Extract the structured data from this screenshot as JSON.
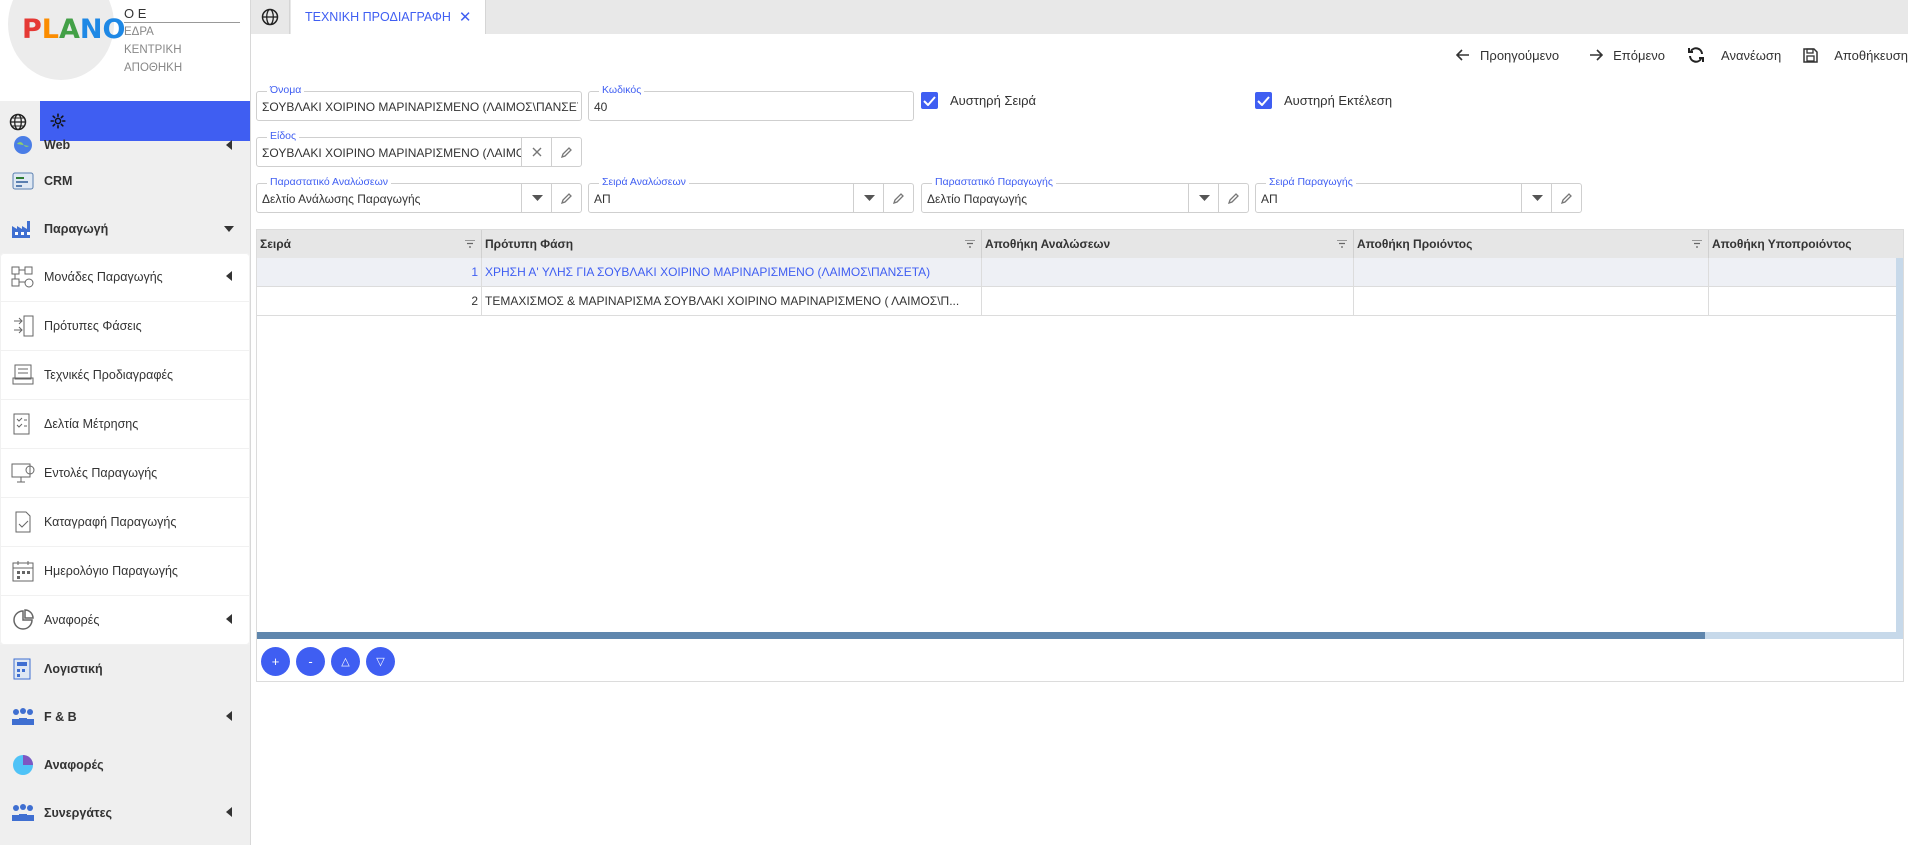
{
  "logo": {
    "text_letters": [
      "P",
      "L",
      "A",
      "N",
      "O"
    ],
    "letter_colors": [
      "#e53935",
      "#fb8c00",
      "#43a047",
      "#1e88e5",
      "#1e88e5"
    ]
  },
  "company": {
    "name": "O E",
    "lines": [
      "ΕΔΡΑ",
      "ΚΕΝΤΡΙΚΗ",
      "ΑΠΟΘΗΚΗ"
    ]
  },
  "colors": {
    "accent": "#3f5ef2",
    "sidebar_bg": "#efefef",
    "header_bg": "#e6e6e6",
    "scroll_track": "#c7d9ea",
    "scroll_thumb": "#5f86ad"
  },
  "sidebar": {
    "items": [
      {
        "label": "Web",
        "icon": "globe-color-icon"
      },
      {
        "label": "CRM",
        "icon": "crm-icon"
      },
      {
        "label": "Παραγωγή",
        "icon": "factory-icon"
      }
    ],
    "sub_items": [
      {
        "label": "Μονάδες Παραγωγής",
        "icon": "units-icon"
      },
      {
        "label": "Πρότυπες Φάσεις",
        "icon": "phases-icon"
      },
      {
        "label": "Τεχνικές Προδιαγραφές",
        "icon": "specs-icon"
      },
      {
        "label": "Δελτία Μέτρησης",
        "icon": "measurement-icon"
      },
      {
        "label": "Εντολές Παραγωγής",
        "icon": "orders-icon"
      },
      {
        "label": "Καταγραφή Παραγωγής",
        "icon": "record-icon"
      },
      {
        "label": "Ημερολόγιο Παραγωγής",
        "icon": "calendar-icon"
      },
      {
        "label": "Αναφορές",
        "icon": "reports-icon"
      }
    ],
    "bottom_items": [
      {
        "label": "Λογιστική",
        "icon": "accounting-icon"
      },
      {
        "label": "F & B",
        "icon": "fnb-icon"
      },
      {
        "label": "Αναφορές",
        "icon": "pie-chart-icon"
      },
      {
        "label": "Συνεργάτες",
        "icon": "partners-icon"
      }
    ]
  },
  "tabs": {
    "active_label": "ΤΕΧΝΙΚΗ ΠΡΟΔΙΑΓΡΑΦΗ",
    "close_glyph": "✕"
  },
  "toolbar": {
    "prev": "Προηγούμενο",
    "next": "Επόμενο",
    "refresh": "Ανανέωση",
    "save": "Αποθήκευση"
  },
  "form": {
    "name_label": "Όνομα",
    "name_value": "ΣΟΥΒΛΑΚΙ ΧΟΙΡΙΝΟ ΜΑΡΙΝΑΡΙΣΜΕΝΟ (ΛΑΙΜΟΣ\\ΠΑΝΣΕΤΑ)",
    "code_label": "Κωδικός",
    "code_value": "40",
    "strict_order_label": "Αυστηρή Σειρά",
    "strict_order_checked": true,
    "strict_exec_label": "Αυστηρή Εκτέλεση",
    "strict_exec_checked": true,
    "item_label": "Είδος",
    "item_value": "ΣΟΥΒΛΑΚΙ ΧΟΙΡΙΝΟ ΜΑΡΙΝΑΡΙΣΜΕΝΟ (ΛΑΙΜΟ...",
    "consumption_doc_label": "Παραστατικό Αναλώσεων",
    "consumption_doc_value": "Δελτίο Ανάλωσης Παραγωγής",
    "consumption_series_label": "Σειρά Αναλώσεων",
    "consumption_series_value": "ΑΠ",
    "production_doc_label": "Παραστατικό Παραγωγής",
    "production_doc_value": "Δελτίο Παραγωγής",
    "production_series_label": "Σειρά Παραγωγής",
    "production_series_value": "ΑΠ"
  },
  "grid": {
    "columns": [
      "Σειρά",
      "Πρότυπη Φάση",
      "Αποθήκη Αναλώσεων",
      "Αποθήκη Προιόντος",
      "Αποθήκη Υποπροιόντος"
    ],
    "rows": [
      {
        "order": "1",
        "phase": "ΧΡΗΣΗ Α' ΥΛΗΣ ΓΙΑ ΣΟΥΒΛΑΚΙ ΧΟΙΡΙΝΟ ΜΑΡΙΝΑΡΙΣΜΕΝΟ (ΛΑΙΜΟΣ\\ΠΑΝΣΕΤΑ)",
        "consumption_wh": "",
        "product_wh": "",
        "byproduct_wh": "",
        "selected": true
      },
      {
        "order": "2",
        "phase": "ΤΕΜΑΧΙΣΜΟΣ & ΜΑΡΙΝΑΡΙΣΜΑ ΣΟΥΒΛΑΚΙ ΧΟΙΡΙΝΟ ΜΑΡΙΝΑΡΙΣΜΕΝΟ ( ΛΑΙΜΟΣ\\Π...",
        "consumption_wh": "",
        "product_wh": "",
        "byproduct_wh": "",
        "selected": false
      }
    ],
    "buttons": {
      "add": "+",
      "remove": "-",
      "up": "△",
      "down": "▽"
    },
    "hscroll_fraction": 0.88
  }
}
